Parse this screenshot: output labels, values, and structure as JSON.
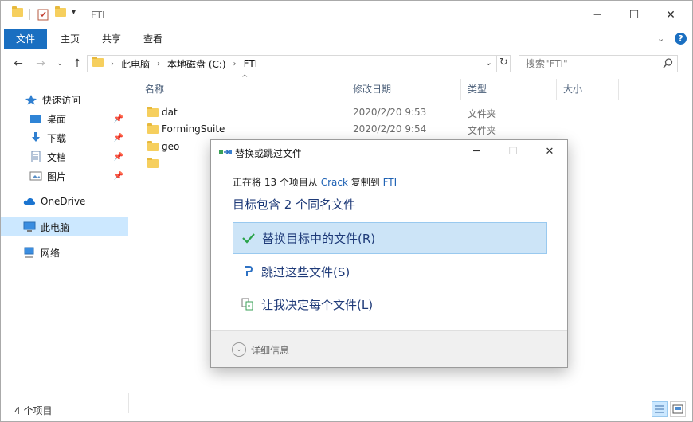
{
  "window": {
    "title": "FTI",
    "controls": {
      "minimize": "─",
      "maximize": "☐",
      "close": "✕"
    }
  },
  "ribbon": {
    "tabs": [
      "文件",
      "主页",
      "共享",
      "查看"
    ],
    "help": "?"
  },
  "address": {
    "crumbs": [
      "此电脑",
      "本地磁盘 (C:)",
      "FTI"
    ],
    "search_placeholder": "搜索\"FTI\""
  },
  "nav_pane": {
    "items": [
      {
        "label": "快速访问",
        "icon": "star-icon"
      },
      {
        "label": "桌面",
        "icon": "desktop-icon",
        "pinned": true
      },
      {
        "label": "下载",
        "icon": "download-icon",
        "pinned": true
      },
      {
        "label": "文档",
        "icon": "document-icon",
        "pinned": true
      },
      {
        "label": "图片",
        "icon": "pictures-icon",
        "pinned": true
      },
      {
        "label": "OneDrive",
        "icon": "cloud-icon"
      },
      {
        "label": "此电脑",
        "icon": "computer-icon",
        "selected": true
      },
      {
        "label": "网络",
        "icon": "network-icon"
      }
    ]
  },
  "file_list": {
    "columns": [
      "名称",
      "修改日期",
      "类型",
      "大小"
    ],
    "rows": [
      {
        "name": "dat",
        "date": "2020/2/20 9:53",
        "type": "文件夹"
      },
      {
        "name": "FormingSuite",
        "date": "2020/2/20 9:54",
        "type": "文件夹"
      },
      {
        "name": "geo",
        "date": "",
        "type": ""
      }
    ]
  },
  "status": {
    "count": "4 个项目"
  },
  "dialog": {
    "title": "替换或跳过文件",
    "copy_prefix": "正在将 13 个项目从 ",
    "source": "Crack",
    "copy_mid": " 复制到 ",
    "dest": "FTI",
    "heading": "目标包含 2 个同名文件",
    "options": {
      "replace": "替换目标中的文件(R)",
      "skip": "跳过这些文件(S)",
      "decide": "让我决定每个文件(L)"
    },
    "more_details": "详细信息"
  },
  "colors": {
    "accent": "#1a6fc1",
    "folder": "#f6cf5e",
    "selected_option": "#cce4f7",
    "check_green": "#2aa34a"
  }
}
